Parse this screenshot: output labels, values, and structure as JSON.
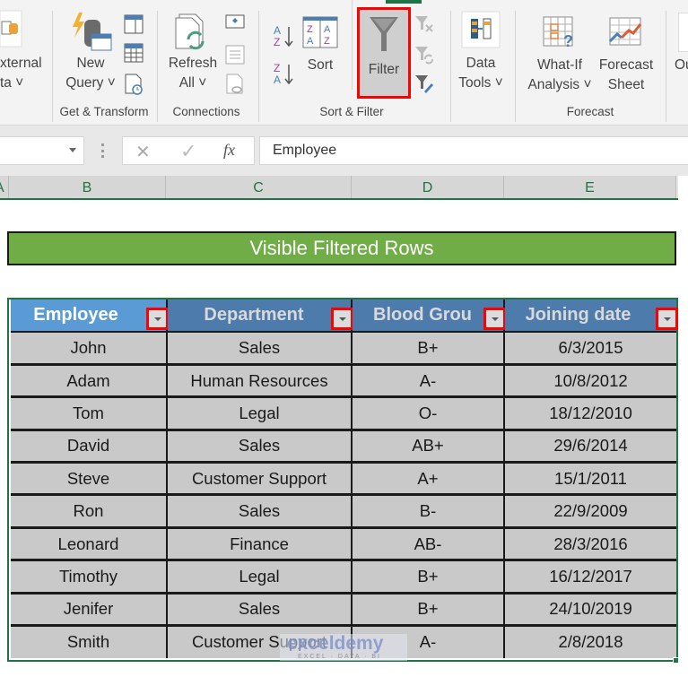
{
  "ribbon": {
    "groups": [
      {
        "label": "Get & Transform"
      },
      {
        "label": "Connections"
      },
      {
        "label": "Sort & Filter"
      },
      {
        "label": "Forecast"
      }
    ],
    "buttons": {
      "get_external_data": {
        "line1": "xternal",
        "line2": "ta ˅"
      },
      "new_query": {
        "line1": "New",
        "line2": "Query ˅"
      },
      "refresh_all": {
        "line1": "Refresh",
        "line2": "All ˅"
      },
      "sort": {
        "label": "Sort"
      },
      "filter": {
        "label": "Filter",
        "highlighted": true
      },
      "data_tools": {
        "line1": "Data",
        "line2": "Tools ˅"
      },
      "what_if": {
        "line1": "What-If",
        "line2": "Analysis ˅"
      },
      "forecast_sheet": {
        "line1": "Forecast",
        "line2": "Sheet"
      },
      "outline": {
        "label": "Ou"
      }
    },
    "highlight_color": "#ff0000"
  },
  "formula_bar": {
    "name_box": "",
    "cancel_symbol": "✕",
    "enter_symbol": "✓",
    "fx_symbol": "fx",
    "value": "Employee"
  },
  "column_headers": [
    "A",
    "B",
    "C",
    "D",
    "E"
  ],
  "banner": {
    "text": "Visible Filtered Rows",
    "color": "#70ad47"
  },
  "table": {
    "headers": [
      "Employee",
      "Department",
      "Blood Group",
      "Joining date"
    ],
    "header_display": [
      "Employee",
      "Department",
      "Blood Grou",
      "Joining date"
    ],
    "rows": [
      [
        "John",
        "Sales",
        "B+",
        "6/3/2015"
      ],
      [
        "Adam",
        "Human Resources",
        "A-",
        "10/8/2012"
      ],
      [
        "Tom",
        "Legal",
        "O-",
        "18/12/2010"
      ],
      [
        "David",
        "Sales",
        "AB+",
        "29/6/2014"
      ],
      [
        "Steve",
        "Customer Support",
        "A+",
        "15/1/2011"
      ],
      [
        "Ron",
        "Sales",
        "B-",
        "22/9/2009"
      ],
      [
        "Leonard",
        "Finance",
        "AB-",
        "28/3/2016"
      ],
      [
        "Timothy",
        "Legal",
        "B+",
        "16/12/2017"
      ],
      [
        "Jenifer",
        "Sales",
        "B+",
        "24/10/2019"
      ],
      [
        "Smith",
        "Customer Support",
        "A-",
        "2/8/2018"
      ]
    ]
  },
  "watermark": {
    "brand": "exceldemy",
    "tagline": "EXCEL · DATA · BI"
  }
}
